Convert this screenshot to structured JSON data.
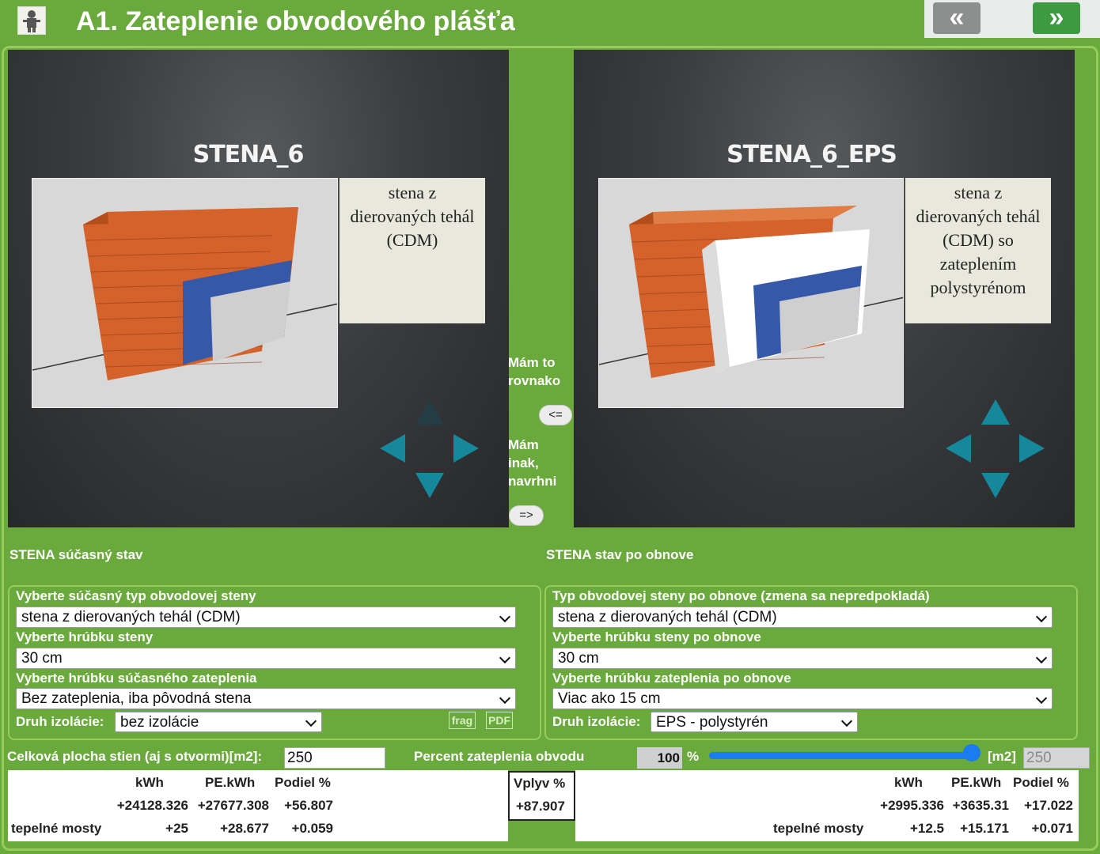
{
  "header": {
    "title": "A1. Zateplenie obvodového plášťa",
    "back_label": "«",
    "forward_label": "»"
  },
  "current_panel": {
    "wall_name": "STENA_6",
    "description": [
      "stena z",
      "dierovaných tehál",
      "(CDM)"
    ]
  },
  "renovated_panel": {
    "wall_name": "STENA_6_EPS",
    "description": [
      "stena z",
      "dierovaných tehál",
      "(CDM) so",
      "zateplením",
      "polystyrénom"
    ]
  },
  "middle": {
    "same_text": [
      "Mám to",
      "rovnako"
    ],
    "same_button": "<=",
    "other_text": [
      "Mám",
      "inak,",
      "navrhni"
    ],
    "other_button": "=>"
  },
  "current_form": {
    "section_title": "STENA súčasný stav",
    "type_label": "Vyberte súčasný typ obvodovej steny",
    "type_value": "stena z dierovaných tehál (CDM)",
    "thickness_label": "Vyberte hrúbku steny",
    "thickness_value": "30 cm",
    "insulation_thickness_label": "Vyberte hrúbku súčasného zateplenia",
    "insulation_thickness_value": "Bez zateplenia, iba pôvodná stena",
    "insulation_type_label": "Druh izolácie:",
    "insulation_type_value": "bez izolácie",
    "frag_label": "frag",
    "pdf_label": "PDF"
  },
  "renovated_form": {
    "section_title": "STENA stav po obnove",
    "type_label": "Typ obvodovej steny po obnove (zmena sa nepredpokladá)",
    "type_value": "stena z dierovaných tehál (CDM)",
    "thickness_label": "Vyberte hrúbku steny po obnove",
    "thickness_value": "30 cm",
    "insulation_thickness_label": "Vyberte hrúbku zateplenia po obnove",
    "insulation_thickness_value": "Viac ako 15 cm",
    "insulation_type_label": "Druh izolácie:",
    "insulation_type_value": "EPS - polystyrén"
  },
  "area_row": {
    "total_area_label": "Celková plocha stien (aj s otvormi)[m2]:",
    "total_area_value": "250",
    "percent_label": "Percent zateplenia obvodu",
    "percent_value": "100",
    "percent_unit": "%",
    "slider_fraction": 1.0,
    "m2_label": "[m2]",
    "m2_value": "250"
  },
  "results_current": {
    "headers": [
      "kWh",
      "PE.kWh",
      "Podiel %"
    ],
    "row1": [
      "+24128.326",
      "+27677.308",
      "+56.807"
    ],
    "bridges_label": "tepelné mosty",
    "row2": [
      "+25",
      "+28.677",
      "+0.059"
    ]
  },
  "impact": {
    "label": "Vplyv %",
    "value": "+87.907"
  },
  "results_renovated": {
    "headers": [
      "kWh",
      "PE.kWh",
      "Podiel %"
    ],
    "row1": [
      "+2995.336",
      "+3635.31",
      "+17.022"
    ],
    "bridges_label": "tepelné mosty",
    "row2": [
      "+12.5",
      "+15.171",
      "+0.071"
    ]
  },
  "colors": {
    "background_green": "#6aa93c",
    "border_green": "#95cc5c",
    "arrow_teal": "#16889c",
    "brick": "#d4622a",
    "insulation_blue": "#3558a8",
    "slider_blue": "#1a7cf0"
  }
}
